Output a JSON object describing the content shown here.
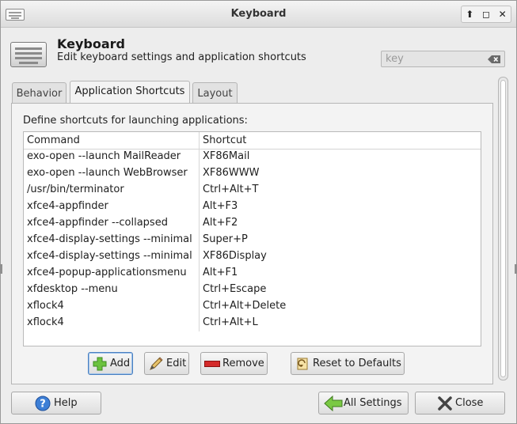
{
  "window": {
    "title": "Keyboard",
    "controls": [
      "⬆",
      "◻",
      "✕"
    ]
  },
  "header": {
    "title": "Keyboard",
    "subtitle": "Edit keyboard settings and application shortcuts",
    "search_placeholder": "key"
  },
  "tabs": [
    {
      "label": "Behavior",
      "active": false
    },
    {
      "label": "Application Shortcuts",
      "active": true
    },
    {
      "label": "Layout",
      "active": false
    }
  ],
  "shortcuts": {
    "description": "Define shortcuts for launching applications:",
    "columns": [
      "Command",
      "Shortcut"
    ],
    "rows": [
      {
        "command": "exo-open --launch MailReader",
        "shortcut": "XF86Mail"
      },
      {
        "command": "exo-open --launch WebBrowser",
        "shortcut": "XF86WWW"
      },
      {
        "command": "/usr/bin/terminator",
        "shortcut": "Ctrl+Alt+T"
      },
      {
        "command": "xfce4-appfinder",
        "shortcut": "Alt+F3"
      },
      {
        "command": "xfce4-appfinder --collapsed",
        "shortcut": "Alt+F2"
      },
      {
        "command": "xfce4-display-settings --minimal",
        "shortcut": "Super+P"
      },
      {
        "command": "xfce4-display-settings --minimal",
        "shortcut": "XF86Display"
      },
      {
        "command": "xfce4-popup-applicationsmenu",
        "shortcut": "Alt+F1"
      },
      {
        "command": "xfdesktop --menu",
        "shortcut": "Ctrl+Escape"
      },
      {
        "command": "xflock4",
        "shortcut": "Ctrl+Alt+Delete"
      },
      {
        "command": "xflock4",
        "shortcut": "Ctrl+Alt+L"
      }
    ]
  },
  "actions": {
    "add": "Add",
    "edit": "Edit",
    "remove": "Remove",
    "reset": "Reset to Defaults"
  },
  "footer": {
    "help": "Help",
    "all_settings": "All Settings",
    "close": "Close"
  },
  "colors": {
    "add_icon": "#5fb83a",
    "remove_icon": "#cc2222",
    "help_icon": "#3d7fd6",
    "back_arrow": "#7ac943"
  }
}
